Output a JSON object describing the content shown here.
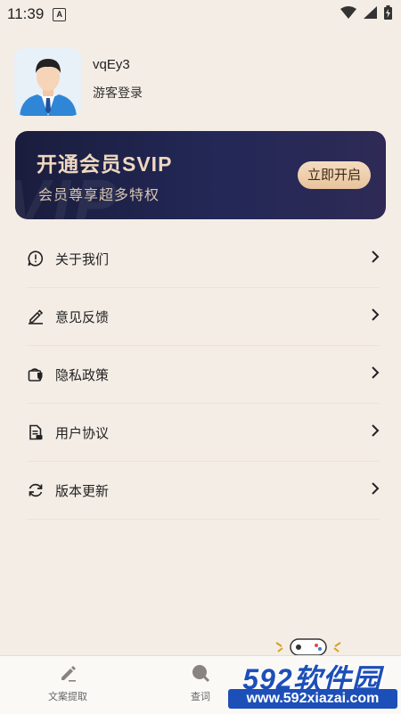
{
  "status_bar": {
    "time": "11:39",
    "notification_letter": "A"
  },
  "profile": {
    "username": "vqEy3",
    "login_type": "游客登录"
  },
  "vip_card": {
    "title": "开通会员SVIP",
    "subtitle": "会员尊享超多特权",
    "button_label": "立即开启",
    "watermark_text": "VIP"
  },
  "menu": {
    "items": [
      {
        "label": "关于我们",
        "icon": "info-bubble-icon"
      },
      {
        "label": "意见反馈",
        "icon": "pencil-icon"
      },
      {
        "label": "隐私政策",
        "icon": "privacy-icon"
      },
      {
        "label": "用户协议",
        "icon": "document-icon"
      },
      {
        "label": "版本更新",
        "icon": "refresh-icon"
      }
    ]
  },
  "bottom_nav": {
    "items": [
      {
        "label": "文案提取",
        "icon": "pencil-icon"
      },
      {
        "label": "查词",
        "icon": "search-icon"
      }
    ]
  },
  "watermark": {
    "brand": "592软件园",
    "url": "www.592xiazai.com"
  },
  "colors": {
    "background": "#f4ede6",
    "vip_gold": "#efd8bf",
    "vip_dark": "#1a1d3d",
    "watermark_blue": "#1d4fb8"
  }
}
